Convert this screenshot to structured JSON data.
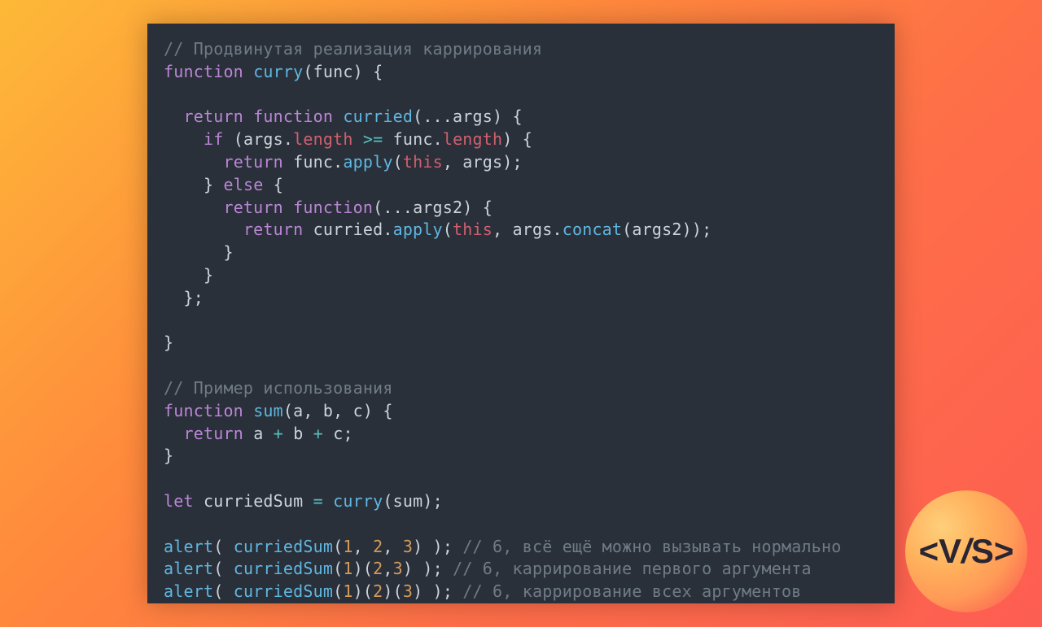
{
  "code": {
    "comment_top": "// Продвинутая реализация каррирования",
    "kw_function_1": "function",
    "fn_curry": "curry",
    "param_func": "func",
    "kw_return_1": "return",
    "kw_function_2": "function",
    "fn_curried": "curried",
    "spread_args": "...args",
    "kw_if": "if",
    "id_args1": "args",
    "prop_length1": "length",
    "op_ge": ">=",
    "id_func1": "func",
    "prop_length2": "length",
    "kw_return_2": "return",
    "id_func2": "func",
    "fn_apply1": "apply",
    "kw_this1": "this",
    "id_args2": "args",
    "kw_else": "else",
    "kw_return_3": "return",
    "kw_function_3": "function",
    "spread_args2": "...args2",
    "kw_return_4": "return",
    "fn_curried_call": "curried",
    "fn_apply2": "apply",
    "kw_this2": "this",
    "id_args3": "args",
    "fn_concat": "concat",
    "id_args2b": "args2",
    "comment_example": "// Пример использования",
    "kw_function_4": "function",
    "fn_sum": "sum",
    "param_a": "a",
    "param_b": "b",
    "param_c": "c",
    "kw_return_5": "return",
    "id_a": "a",
    "op_plus1": "+",
    "id_b": "b",
    "op_plus2": "+",
    "id_c": "c",
    "kw_let": "let",
    "id_curriedSum": "curriedSum",
    "op_eq": "=",
    "fn_curry_call": "curry",
    "id_sum_arg": "sum",
    "fn_alert1": "alert",
    "fn_curriedSum1": "curriedSum",
    "n1a": "1",
    "n1b": "2",
    "n1c": "3",
    "comment_l1": "// 6, всё ещё можно вызывать нормально",
    "fn_alert2": "alert",
    "fn_curriedSum2": "curriedSum",
    "n2a": "1",
    "n2b": "2",
    "n2c": "3",
    "comment_l2": "// 6, каррирование первого аргумента",
    "fn_alert3": "alert",
    "fn_curriedSum3": "curriedSum",
    "n3a": "1",
    "n3b": "2",
    "n3c": "3",
    "comment_l3": "// 6, каррирование всех аргументов"
  },
  "badge": {
    "lt": "<",
    "v": "V",
    "slash": "/",
    "s": "S",
    "gt": ">"
  }
}
